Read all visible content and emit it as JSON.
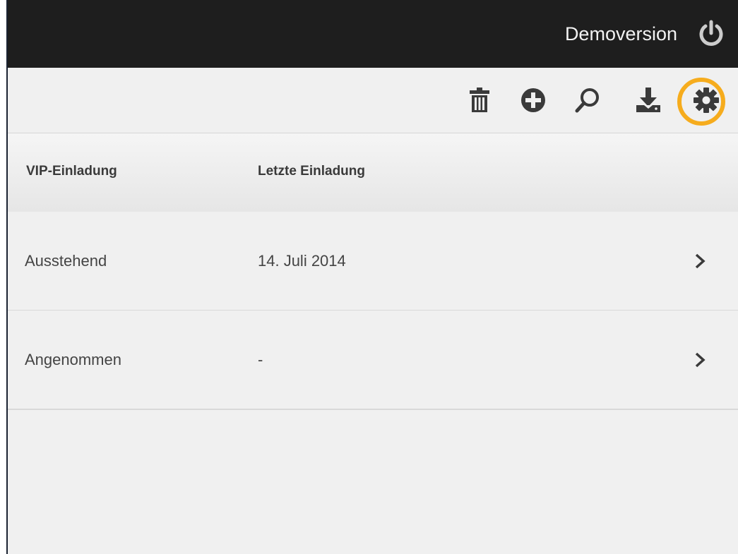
{
  "header": {
    "account_name": "Demoversion",
    "power_icon": "power-icon"
  },
  "toolbar": {
    "icons": [
      "trash-icon",
      "add-circle-icon",
      "search-icon",
      "download-icon",
      "gear-icon"
    ],
    "highlight_color": "#f6ac1d"
  },
  "table": {
    "columns": [
      "VIP-Einladung",
      "Letzte Einladung"
    ],
    "rows": [
      {
        "status": "Ausstehend",
        "last_invite": "14. Juli 2014"
      },
      {
        "status": "Angenommen",
        "last_invite": "-"
      }
    ]
  },
  "colors": {
    "top_bar": "#1e1e1e",
    "background": "#f0f0f0",
    "accent": "#f6ac1d"
  }
}
